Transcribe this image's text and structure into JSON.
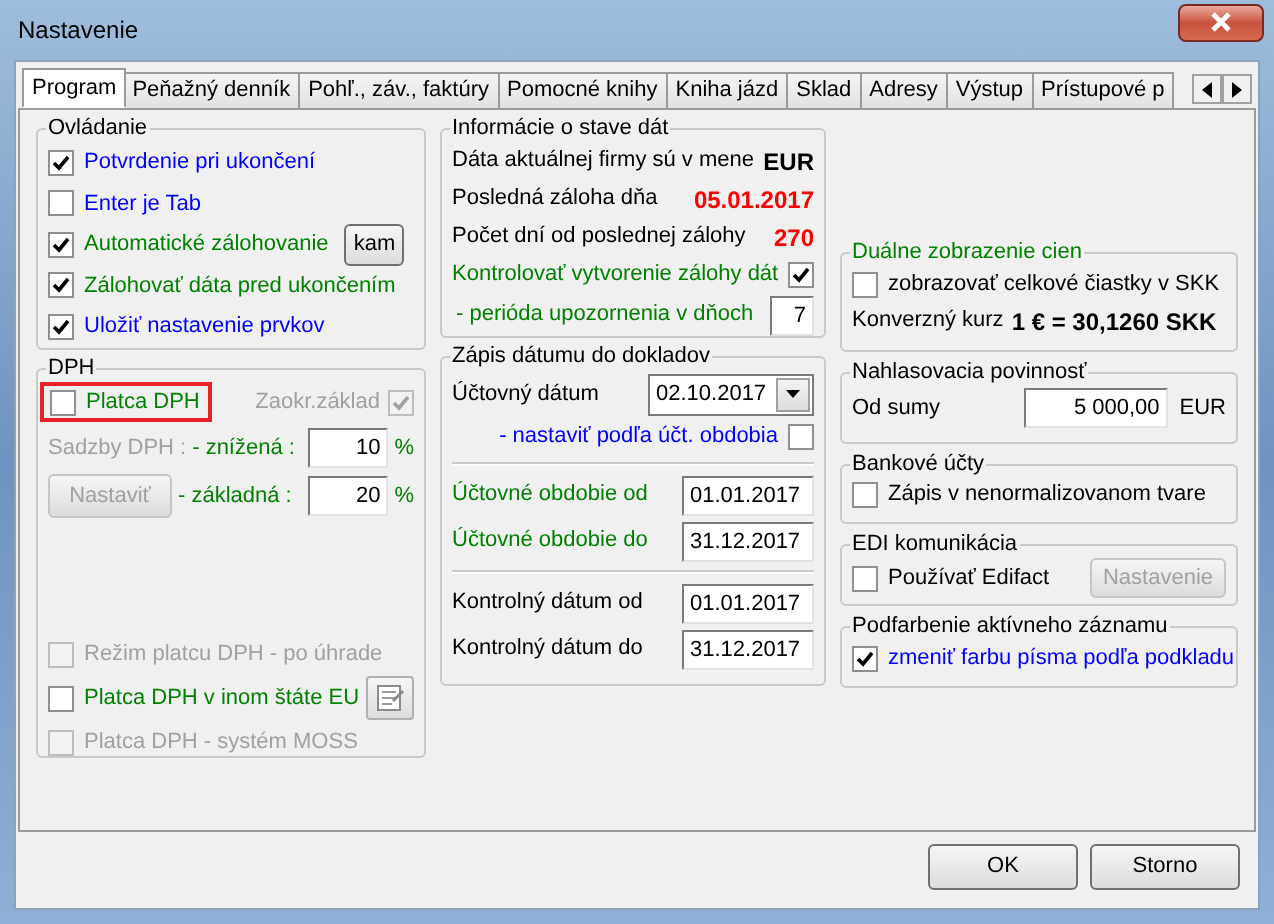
{
  "window": {
    "title": "Nastavenie"
  },
  "tabs": [
    {
      "label": "Program",
      "selected": true
    },
    {
      "label": "Peňažný denník",
      "selected": false
    },
    {
      "label": "Pohľ., záv., faktúry",
      "selected": false
    },
    {
      "label": "Pomocné knihy",
      "selected": false
    },
    {
      "label": "Kniha jázd",
      "selected": false
    },
    {
      "label": "Sklad",
      "selected": false
    },
    {
      "label": "Adresy",
      "selected": false
    },
    {
      "label": "Výstup",
      "selected": false
    },
    {
      "label": "Prístupové p",
      "selected": false
    }
  ],
  "ovladanie": {
    "title": "Ovládanie",
    "items": [
      {
        "label": "Potvrdenie pri ukončení",
        "checked": true,
        "color": "#0000ff"
      },
      {
        "label": "Enter je Tab",
        "checked": false,
        "color": "#0000ff"
      },
      {
        "label": "Automatické zálohovanie",
        "checked": true,
        "color": "#008000",
        "button": "kam"
      },
      {
        "label": "Zálohovať dáta pred ukončením",
        "checked": true,
        "color": "#008000"
      },
      {
        "label": "Uložiť nastavenie prvkov",
        "checked": true,
        "color": "#0000ff"
      }
    ]
  },
  "dph": {
    "title": "DPH",
    "platca": {
      "label": "Platca DPH",
      "checked": false,
      "highlighted": true
    },
    "zaokr": {
      "label": "Zaokr.základ",
      "checked": true,
      "disabled": true
    },
    "sadzby_label": "Sadzby DPH :",
    "rates": [
      {
        "label": "- znížená :",
        "value": "10",
        "unit": "%"
      },
      {
        "label": "- základná :",
        "value": "20",
        "unit": "%"
      }
    ],
    "button": {
      "label": "Nastaviť",
      "disabled": true
    },
    "options": [
      {
        "label": "Režim platcu DPH - po úhrade",
        "checked": false,
        "disabled": true,
        "has_button": false
      },
      {
        "label": "Platca DPH v inom štáte EU",
        "checked": false,
        "disabled": false,
        "has_button": true
      },
      {
        "label": "Platca DPH - systém MOSS",
        "checked": false,
        "disabled": true,
        "has_button": false
      }
    ]
  },
  "info": {
    "title": "Informácie o stave dát",
    "rows": [
      {
        "kind": "value",
        "label": "Dáta aktuálnej firmy sú v mene",
        "value": "EUR",
        "color": "#000000"
      },
      {
        "kind": "value",
        "label": "Posledná záloha dňa",
        "value": "05.01.2017",
        "color": "#ff0000"
      },
      {
        "kind": "value",
        "label": "Počet dní od poslednej zálohy",
        "value": "270",
        "color": "#ff0000"
      },
      {
        "kind": "check",
        "label": "Kontrolovať vytvorenie zálohy dát",
        "checked": true
      },
      {
        "kind": "field",
        "label": "- perióda upozornenia v dňoch",
        "value": "7"
      }
    ]
  },
  "zapis": {
    "title": "Zápis dátumu do dokladov",
    "uctovny_datum": {
      "label": "Účtovný dátum",
      "value": "02.10.2017"
    },
    "nastavit": {
      "label": "- nastaviť podľa účt. obdobia",
      "checked": false
    },
    "obdobie": [
      {
        "label": "Účtovné obdobie od",
        "value": "01.01.2017"
      },
      {
        "label": "Účtovné obdobie do",
        "value": "31.12.2017"
      }
    ],
    "kontrolny": [
      {
        "label": "Kontrolný dátum od",
        "value": "01.01.2017"
      },
      {
        "label": "Kontrolný dátum do",
        "value": "31.12.2017"
      }
    ]
  },
  "dualne": {
    "title": "Duálne zobrazenie cien",
    "check": {
      "label": "zobrazovať celkové čiastky v SKK",
      "checked": false
    },
    "kurz_label": "Konverzný kurz",
    "kurz_value": "1 € = 30,1260 SKK"
  },
  "nahlasovacia": {
    "title": "Nahlasovacia povinnosť",
    "label": "Od sumy",
    "value": "5 000,00",
    "unit": "EUR"
  },
  "bankove": {
    "title": "Bankové účty",
    "check": {
      "label": "Zápis v nenormalizovanom tvare",
      "checked": false
    }
  },
  "edi": {
    "title": "EDI komunikácia",
    "check": {
      "label": "Používať Edifact",
      "checked": false
    },
    "button": {
      "label": "Nastavenie",
      "disabled": true
    }
  },
  "podfarbenie": {
    "title": "Podfarbenie aktívneho záznamu",
    "check": {
      "label": "zmeniť farbu písma podľa podkladu",
      "checked": true
    }
  },
  "buttons": [
    "OK",
    "Storno"
  ]
}
